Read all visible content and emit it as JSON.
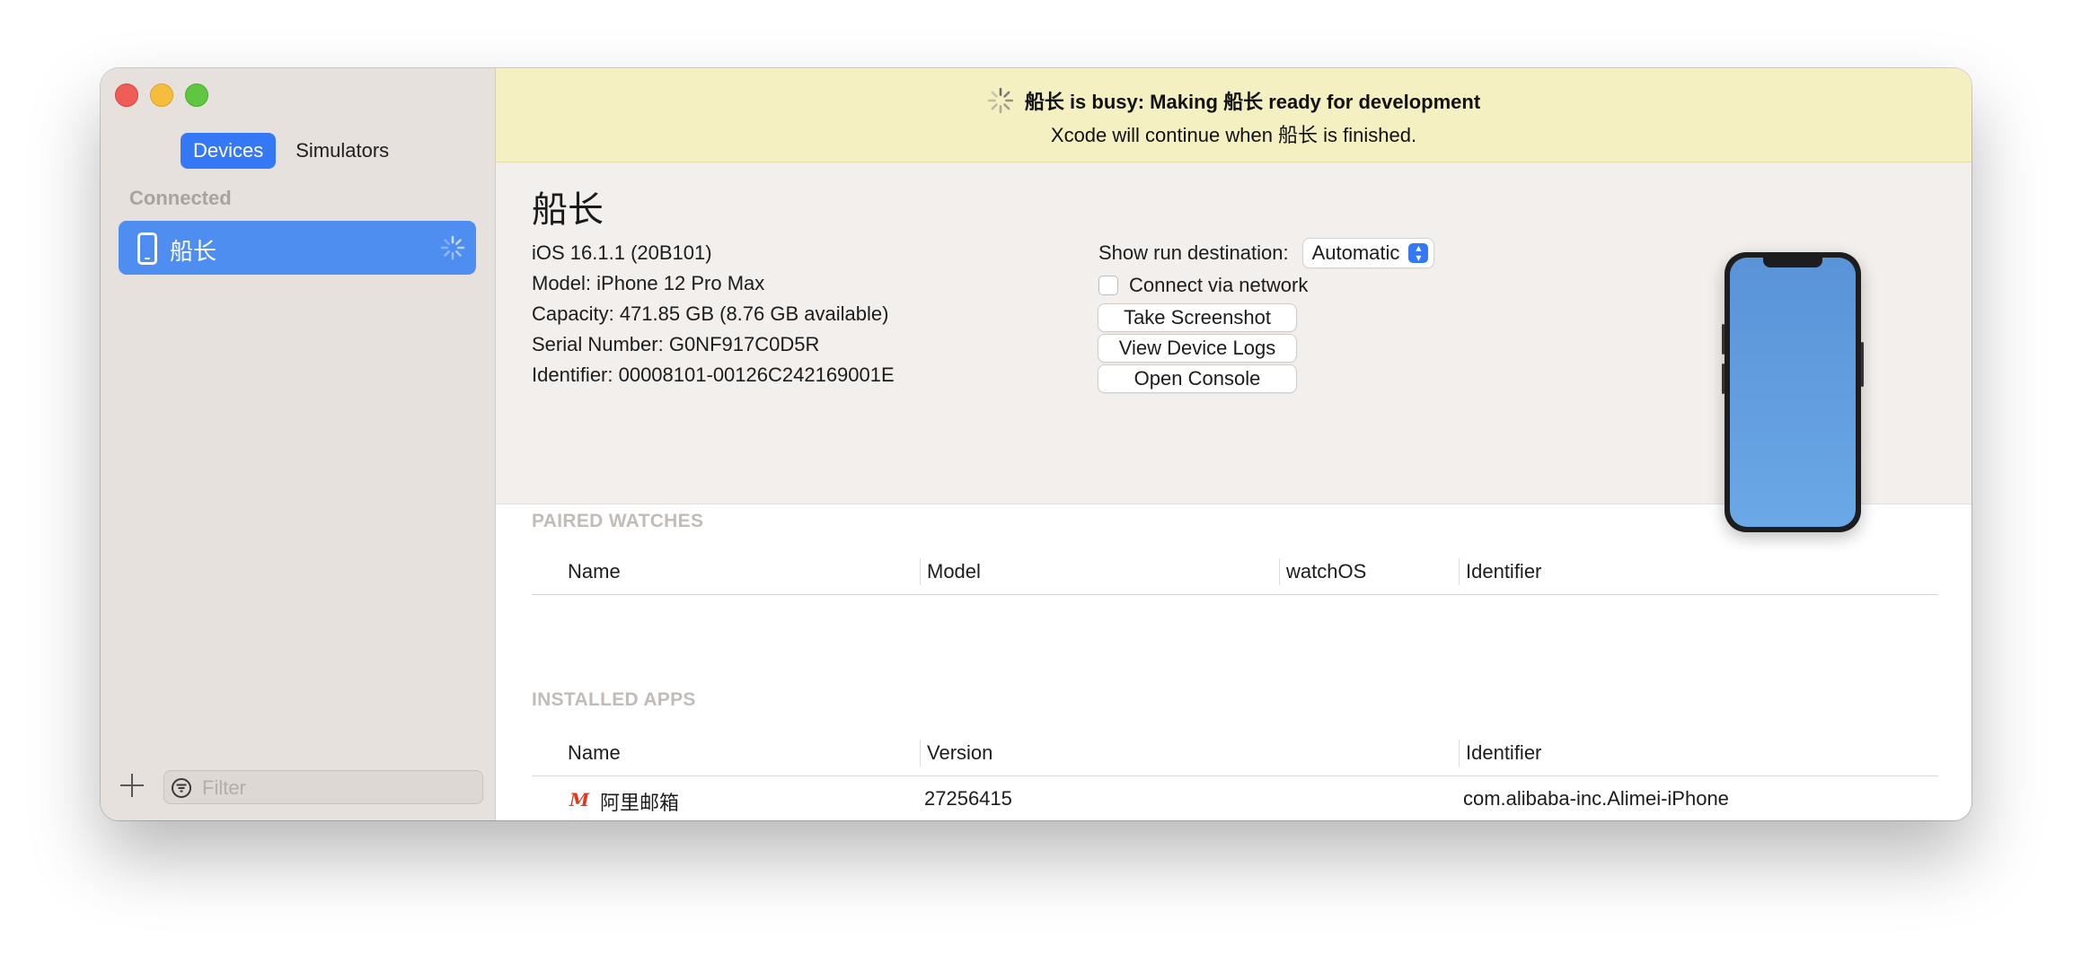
{
  "sidebar": {
    "tabs": [
      {
        "label": "Devices",
        "active": true
      },
      {
        "label": "Simulators",
        "active": false
      }
    ],
    "section_label": "Connected",
    "device": {
      "name": "船长",
      "icon": "iphone-icon",
      "status_icon": "spinner-icon"
    },
    "add_icon": "plus-icon",
    "filter": {
      "placeholder": "Filter",
      "icon": "filter-icon"
    }
  },
  "banner": {
    "title": "船长 is busy: Making 船长 ready for development",
    "subtitle": "Xcode will continue when 船长 is finished.",
    "background": "#f4f0c2"
  },
  "device_info": {
    "name": "船长",
    "lines": [
      "iOS 16.1.1 (20B101)",
      "Model: iPhone 12 Pro Max",
      "Capacity: 471.85 GB (8.76 GB available)",
      "Serial Number: G0NF917C0D5R",
      "Identifier: 00008101-00126C242169001E"
    ],
    "run_destination_label": "Show run destination:",
    "run_destination_value": "Automatic",
    "connect_network_label": "Connect via network",
    "connect_network_checked": false,
    "buttons": {
      "screenshot": "Take Screenshot",
      "logs": "View Device Logs",
      "console": "Open Console"
    }
  },
  "paired_watches": {
    "title": "PAIRED WATCHES",
    "columns": [
      "Name",
      "Model",
      "watchOS",
      "Identifier"
    ],
    "rows": []
  },
  "installed_apps": {
    "title": "INSTALLED APPS",
    "columns": [
      "Name",
      "Version",
      "Identifier"
    ],
    "rows": [
      {
        "name": "阿里邮箱",
        "version": "27256415",
        "identifier": "com.alibaba-inc.Alimei-iPhone",
        "icon": "alimail-app-icon"
      }
    ]
  },
  "colors": {
    "accent": "#3478f6",
    "selected_row": "#4d8ef0",
    "sidebar_bg": "#e6e1dd"
  }
}
